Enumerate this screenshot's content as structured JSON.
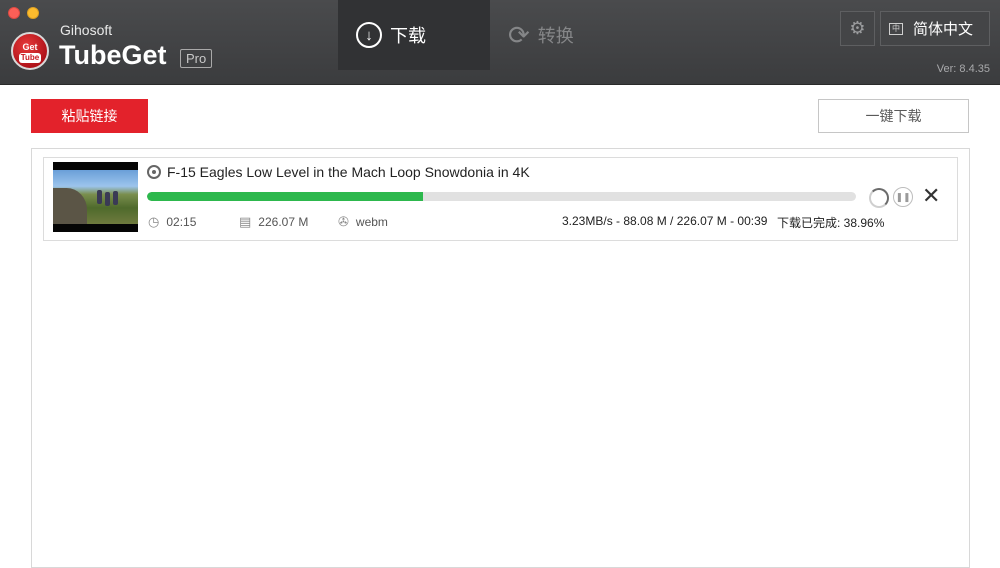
{
  "header": {
    "brand_small": "Gihosoft",
    "brand_big": "TubeGet",
    "edition": "Pro",
    "logo_text_top": "Get",
    "logo_text_bottom": "Tube",
    "tabs": [
      {
        "label": "下载",
        "icon": "download-circle-icon",
        "active": true
      },
      {
        "label": "转换",
        "icon": "convert-arrows-icon",
        "active": false
      }
    ],
    "settings_icon": "gear-icon",
    "language": "简体中文",
    "version": "Ver: 8.4.35"
  },
  "toolbar": {
    "paste_label": "粘贴链接",
    "onekey_label": "一键下载"
  },
  "downloads": [
    {
      "title": "F-15 Eagles Low Level in the Mach Loop Snowdonia in 4K",
      "progress": 0.3896,
      "duration": "02:15",
      "size": "226.07 M",
      "format": "webm",
      "speed_info": "3.23MB/s - 88.08 M / 226.07 M - 00:39",
      "status": "下载已完成:  38.96%"
    }
  ],
  "colors": {
    "accent_red": "#e3222b",
    "progress_green": "#2db84d",
    "titlebar": "#444547"
  }
}
